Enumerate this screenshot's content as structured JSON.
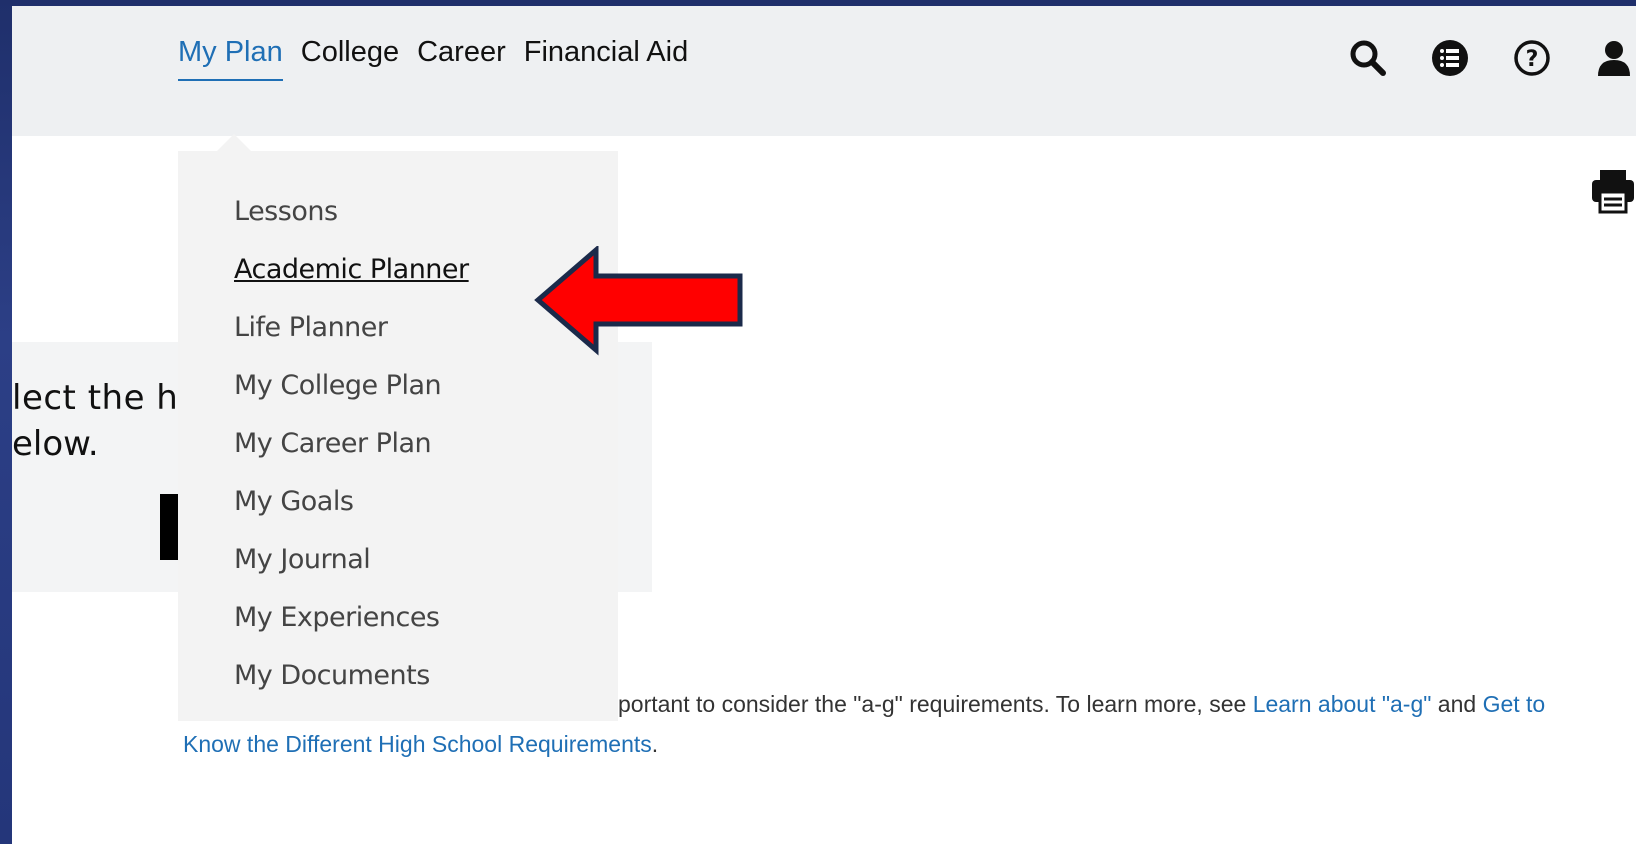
{
  "nav": {
    "links": [
      {
        "label": "My Plan",
        "active": true
      },
      {
        "label": "College"
      },
      {
        "label": "Career"
      },
      {
        "label": "Financial Aid"
      }
    ],
    "icons": [
      "search-icon",
      "list-icon",
      "help-icon",
      "user-icon"
    ]
  },
  "dropdown": {
    "items": [
      {
        "label": "Lessons"
      },
      {
        "label": "Academic Planner",
        "underlined": true
      },
      {
        "label": "Life Planner"
      },
      {
        "label": "My College Plan"
      },
      {
        "label": "My Career Plan"
      },
      {
        "label": "My Goals"
      },
      {
        "label": "My Journal"
      },
      {
        "label": "My Experiences"
      },
      {
        "label": "My Documents"
      }
    ]
  },
  "hero": {
    "line1": "lect the hig",
    "line2": "elow."
  },
  "info": {
    "text_prefix": "portant to consider the \"a-g\" requirements. To learn more, see ",
    "link1": "Learn about \"a-g\"",
    "and_text": " and ",
    "link2": "Get to Know the Different High School Requirements",
    "suffix": "."
  },
  "toolbar": {
    "print_icon": "print-icon"
  },
  "annotation": {
    "arrow_color": "#ff0000",
    "arrow_outline": "#1b2a4a"
  },
  "colors": {
    "accent": "#1f6fb5",
    "nav_bg": "#eef0f2",
    "dropdown_bg": "#f3f3f3"
  }
}
